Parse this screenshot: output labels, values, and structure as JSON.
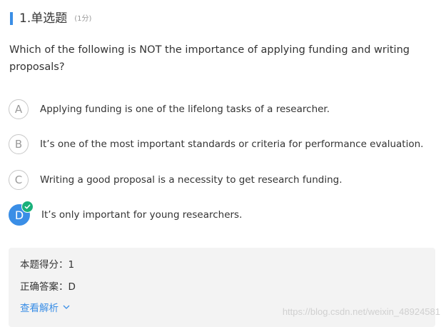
{
  "question": {
    "title": "1.单选题",
    "score": "(1分)",
    "stem": "Which of the following is NOT the importance of applying funding and writing proposals?"
  },
  "options": [
    {
      "letter": "A",
      "text": "Applying funding is one of the lifelong tasks of a researcher.",
      "selected": false
    },
    {
      "letter": "B",
      "text": "It’s one of the most important standards or criteria for performance evaluation.",
      "selected": false
    },
    {
      "letter": "C",
      "text": "Writing a good proposal is a necessity to get research funding.",
      "selected": false
    },
    {
      "letter": "D",
      "text": "It’s only important for young researchers.",
      "selected": true
    }
  ],
  "result": {
    "score_line": "本题得分：1",
    "answer_line": "正确答案：D",
    "analysis_label": "查看解析"
  },
  "watermark": "https://blog.csdn.net/weixin_48924581",
  "colors": {
    "accent": "#3a8ee6",
    "correct": "#19b07a",
    "panel": "#f3f3f3"
  }
}
